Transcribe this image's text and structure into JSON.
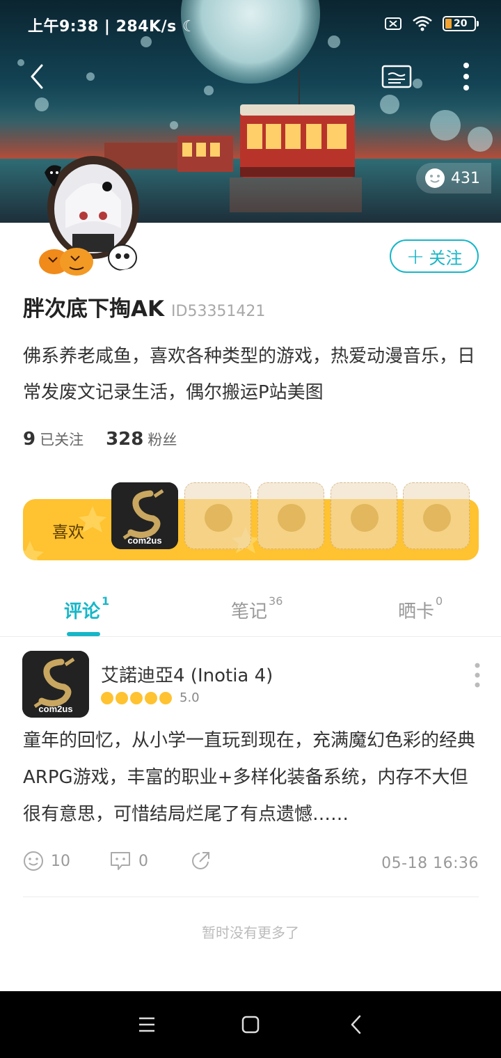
{
  "status_bar": {
    "time": "上午9:38",
    "speed": "284K/s",
    "battery": "20"
  },
  "header": {
    "likes_count": "431"
  },
  "profile": {
    "follow_label": "关注",
    "username": "胖次底下掏AK",
    "user_id": "ID53351421",
    "bio": "佛系养老咸鱼，喜欢各种类型的游戏，热爱动漫音乐，日常发废文记录生活，偶尔搬运P站美图",
    "following_count": "9",
    "following_label": "已关注",
    "followers_count": "328",
    "followers_label": "粉丝"
  },
  "favorites": {
    "label": "喜欢",
    "game_logo_text": "com2us"
  },
  "tabs": [
    {
      "label": "评论",
      "count": "1",
      "active": true
    },
    {
      "label": "笔记",
      "count": "36",
      "active": false
    },
    {
      "label": "晒卡",
      "count": "0",
      "active": false
    }
  ],
  "review": {
    "game_title": "艾諾迪亞4 (Inotia 4)",
    "rating": "5.0",
    "logo_text": "com2us",
    "text": "童年的回忆，从小学一直玩到现在，充满魔幻色彩的经典ARPG游戏，丰富的职业+多样化装备系统，内存不大但很有意思，可惜结局烂尾了有点遗憾……",
    "like_count": "10",
    "comment_count": "0",
    "timestamp": "05-18 16:36"
  },
  "footer": {
    "no_more": "暂时没有更多了"
  },
  "colors": {
    "accent": "#17b6c7",
    "favorites_bg": "#ffc230",
    "rating": "#ffc230"
  }
}
